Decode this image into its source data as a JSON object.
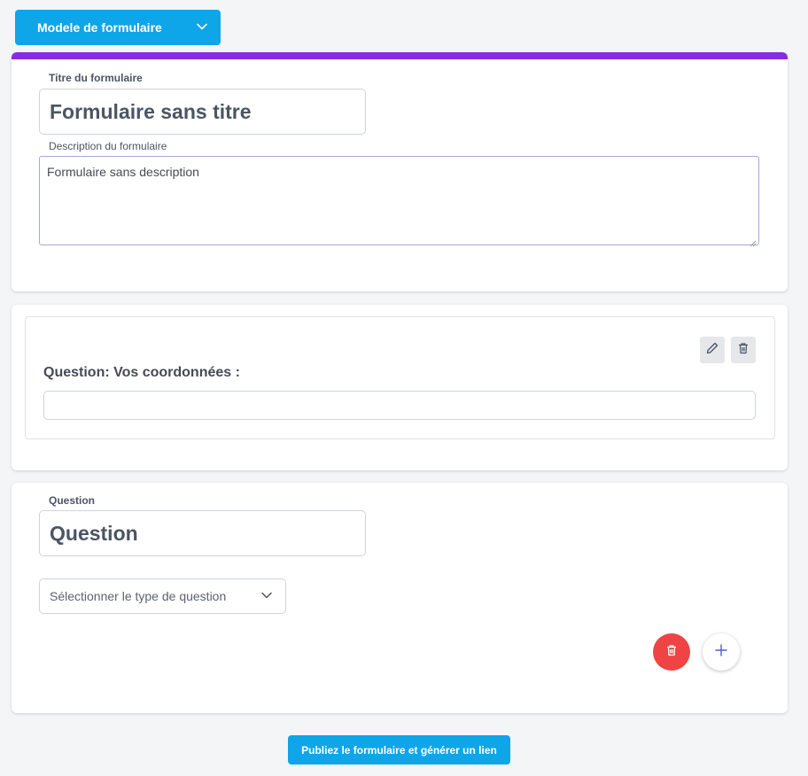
{
  "template_button": {
    "label": "Modele de formulaire",
    "icon": "chevron-down-icon"
  },
  "form_header": {
    "accent_color": "#8a2be2",
    "title_label": "Titre du formulaire",
    "title_value": "Formulaire sans titre",
    "description_label": "Description du formulaire",
    "description_value": "Formulaire sans description"
  },
  "question_card": {
    "title": "Question: Vos coordonnées :",
    "answer_value": "",
    "edit_icon": "pencil-icon",
    "delete_icon": "trash-icon"
  },
  "new_question": {
    "label": "Question",
    "value": "Question",
    "type_select": {
      "placeholder": "Sélectionner le type de question",
      "icon": "chevron-down-icon"
    },
    "delete_icon": "trash-icon",
    "add_icon": "plus-icon"
  },
  "publish_button": {
    "label": "Publiez le formulaire et générer un lien"
  },
  "colors": {
    "primary": "#0ea5e9",
    "danger": "#ef4444",
    "accent": "#8a2be2"
  }
}
